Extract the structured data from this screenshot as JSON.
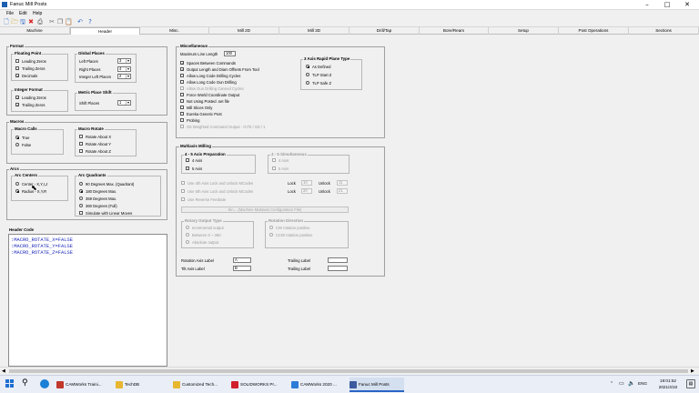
{
  "window": {
    "title": "Fanuc Mill Posts"
  },
  "menu": [
    "File",
    "Edit",
    "Help"
  ],
  "tabs": [
    "Machine",
    "Header",
    "Misc.",
    "Mill 2D",
    "Mill 3D",
    "Drill/Tap",
    "Bore/Ream",
    "Setup",
    "Post Operations",
    "Sections"
  ],
  "active_tab": "Header",
  "format": {
    "title": "Format",
    "floating_point": {
      "title": "Floating Point",
      "items": [
        {
          "label": "Leading Zeros",
          "checked": false
        },
        {
          "label": "Trailing Zeros",
          "checked": false
        },
        {
          "label": "Decimals",
          "checked": true
        }
      ]
    },
    "global_places": {
      "title": "Global Places",
      "items": [
        {
          "label": "Left Places",
          "value": "3"
        },
        {
          "label": "Right Places",
          "value": "4"
        },
        {
          "label": "Integer Left Places",
          "value": "2"
        }
      ]
    },
    "integer_format": {
      "title": "Integer Format",
      "items": [
        {
          "label": "Leading Zeros",
          "checked": true
        },
        {
          "label": "Trailing Zeros",
          "checked": true
        }
      ]
    },
    "metric_place_shift": {
      "title": "Metric Place Shift",
      "label": "Shift Places",
      "value": "1"
    }
  },
  "macros": {
    "title": "Macros",
    "macro_calls": {
      "title": "Macro Calls",
      "items": [
        {
          "label": "True",
          "selected": true
        },
        {
          "label": "False",
          "selected": false
        }
      ]
    },
    "macro_rotate": {
      "title": "Macro Rotate",
      "items": [
        {
          "label": "Rotate About X",
          "checked": false
        },
        {
          "label": "Rotate About Y",
          "checked": false
        },
        {
          "label": "Rotate About Z",
          "checked": false
        }
      ]
    }
  },
  "arcs": {
    "title": "Arcs",
    "arc_centers": {
      "title": "Arc Centers",
      "items": [
        {
          "label": "Center - X,Y,I,J",
          "selected": false
        },
        {
          "label": "Radius - X,Y,R",
          "selected": true
        }
      ]
    },
    "arc_quadrants": {
      "title": "Arc Quadrants",
      "items": [
        {
          "label": "90 Degrees Max. (Quadrant)",
          "selected": false
        },
        {
          "label": "180 Degrees Max.",
          "selected": true
        },
        {
          "label": "359 Degrees Max.",
          "selected": false
        },
        {
          "label": "360 Degrees (Full)",
          "selected": false
        },
        {
          "label": "Simulate with Linear Moves",
          "checked": false
        }
      ]
    }
  },
  "header_code": {
    "title": "Header Code",
    "lines": [
      ":MACRO_ROTATE_X=FALSE",
      ":MACRO_ROTATE_Y=FALSE",
      ":MACRO_ROTATE_Z=FALSE"
    ]
  },
  "misc": {
    "title": "Miscellaneous",
    "max_line_length_label": "Maximum Line Length",
    "max_line_length_value": "100",
    "options": [
      {
        "label": "Spaces Between Commands",
        "checked": true,
        "enabled": true
      },
      {
        "label": "Output Length and Diam Offsets From Tool",
        "checked": true,
        "enabled": true
      },
      {
        "label": "Allow Long Code Drilling Cycles",
        "checked": false,
        "enabled": true
      },
      {
        "label": "Allow Long Code Gun Drilling",
        "checked": false,
        "enabled": true
      },
      {
        "label": "Allow Gun Drilling Canned Cycles",
        "checked": false,
        "enabled": false
      },
      {
        "label": "Force World Coordinate Output",
        "checked": false,
        "enabled": true
      },
      {
        "label": "Not Using Posted .set file",
        "checked": false,
        "enabled": true
      },
      {
        "label": "Mill Slices Only",
        "checked": false,
        "enabled": true
      },
      {
        "label": "Eureka Generic Post",
        "checked": false,
        "enabled": true
      },
      {
        "label": "Probing",
        "checked": false,
        "enabled": true
      },
      {
        "label": "G5 Weighted Command Output - G7/0 / G0 / 1",
        "checked": false,
        "enabled": false
      }
    ],
    "rapid_plane": {
      "title": "3 Axis Rapid Plane Type",
      "items": [
        {
          "label": "As Defined",
          "selected": true
        },
        {
          "label": "TLP Start Z",
          "selected": false
        },
        {
          "label": "TLP Safe Z",
          "selected": false
        }
      ]
    }
  },
  "multiaxis": {
    "title": "Multiaxis Milling",
    "prep": {
      "title": "4 - 5 Axis Preparation",
      "items": [
        "4 Axis",
        "5 Axis"
      ]
    },
    "simul": {
      "title": "4 - 5 Simultaneous",
      "items": [
        "4 Axis",
        "5 Axis"
      ]
    },
    "lock_rows": [
      {
        "label": "Use 4th Axis Lock and Unlock MCodes",
        "lock_label": "Lock",
        "lock": "10",
        "unlock_label": "Unlock",
        "unlock": "11"
      },
      {
        "label": "Use 5th Axis Lock and Unlock MCodes",
        "lock_label": "Lock",
        "lock": "20",
        "unlock_label": "Unlock",
        "unlock": "21"
      }
    ],
    "reverse_feedrate": "Use Reverse Feedrate",
    "kin_button": "Kin... (Machine Multiaxis Configuration File)",
    "rotary_output": {
      "title": "Rotary Output Type",
      "items": [
        "Incremental output",
        "Between 0 ~ 360",
        "Absolute output"
      ]
    },
    "rotation_direction": {
      "title": "Rotation Direction",
      "items": [
        "CW rotation positive",
        "CCW rotation positive"
      ]
    },
    "fields": {
      "rotation_axis_label": "Rotation Axis Label",
      "rotation_axis_value": "A",
      "tilt_axis_label": "Tilt Axis Label",
      "tilt_axis_value": "B",
      "trailing_label_1": "Trailing Label",
      "trailing_label_2": "Trailing Label"
    }
  },
  "taskbar": {
    "items": [
      "CAMWorks Traini...",
      "TechDB",
      "Customized Tech...",
      "SOLIDWORKS Pr...",
      "CAMWorks 2020 ...",
      "Fanuc Mill Posts"
    ],
    "time": "19:01:52",
    "date": "2021/4/10",
    "lang": "ENG"
  }
}
